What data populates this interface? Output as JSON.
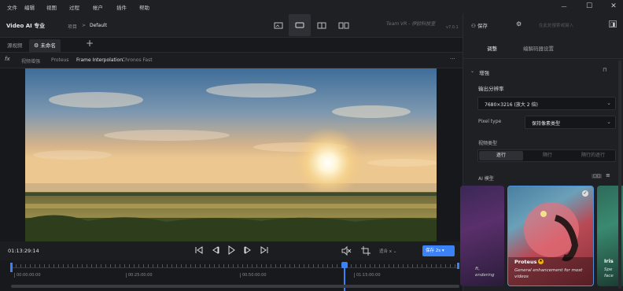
{
  "menu": [
    "文件",
    "编辑",
    "视图",
    "过程",
    "帐户",
    "插件",
    "帮助"
  ],
  "window": {
    "minimize": "—",
    "maximize": "☐",
    "close": "✕"
  },
  "header": {
    "app_name": "Video AI 专业",
    "breadcrumb_root": "项目",
    "breadcrumb_sep": ">",
    "breadcrumb_current": "Default",
    "team": "Team VR - 伊欧科技室",
    "version": "v7.0.1"
  },
  "right_header": {
    "export_label": "保存",
    "search_placeholder": "在此处搜索或键入"
  },
  "tabs": [
    {
      "label": "源视频"
    },
    {
      "label": "未命名"
    }
  ],
  "add_tab": "+",
  "toolbar": {
    "fx": "fx",
    "items": [
      "视频增强",
      "Proteus",
      "Frame Interpolation",
      "Chronos Fast"
    ],
    "more": "···"
  },
  "controls": {
    "timecode": "01:13:29:14",
    "zoom_label": "适合 ⅹ",
    "export_button": "保存 2s"
  },
  "timeline": {
    "marks": [
      "00:00:00:00",
      "00:25:00:00",
      "00:50:00:00",
      "01:15:00:00"
    ]
  },
  "panel": {
    "tabs": [
      "调整",
      "编解码器设置"
    ],
    "section_title": "增强",
    "output_label": "输出分辨率",
    "output_value": "7680×3216 (放大 2 倍)",
    "pixel_label": "Pixel type",
    "pixel_value": "保持像素类型",
    "video_type_label": "视频类型",
    "video_types": [
      "逐行",
      "隔行",
      "隔行的逐行"
    ],
    "ai_label": "AI 模型",
    "view_toggle": "□□",
    "list_toggle": "≡",
    "cards": [
      {
        "title": "",
        "desc": "ft, \nendering"
      },
      {
        "title": "Proteus",
        "desc": "General enhancement for most videos"
      },
      {
        "title": "Iris",
        "desc": "Spe\nface"
      }
    ]
  },
  "colors": {
    "accent": "#3b82f6",
    "panel": "#1f2024",
    "selected_card_border": "#4a90d9",
    "badge": "#f5b400"
  }
}
